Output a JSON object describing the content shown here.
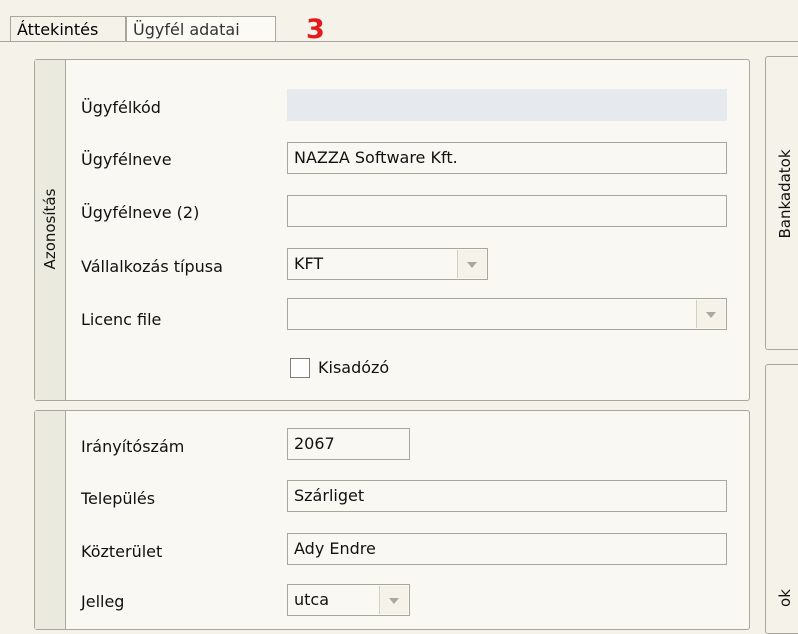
{
  "tabs": [
    {
      "label": "Áttekintés"
    },
    {
      "label": "Ügyfél adatai"
    }
  ],
  "annotation": "3",
  "identification": {
    "title": "Azonosítás",
    "fields": {
      "customer_code": {
        "label": "Ügyfélkód",
        "value": ""
      },
      "customer_name": {
        "label": "Ügyfélneve",
        "value": "NAZZA Software Kft."
      },
      "customer_name2": {
        "label": "Ügyfélneve (2)",
        "value": ""
      },
      "company_type": {
        "label": "Vállalkozás típusa",
        "value": "KFT"
      },
      "license_file": {
        "label": "Licenc file",
        "value": ""
      },
      "small_taxpayer": {
        "label": "Kisadózó",
        "checked": false
      }
    }
  },
  "address": {
    "fields": {
      "zip": {
        "label": "Irányítószám",
        "value": "2067"
      },
      "city": {
        "label": "Település",
        "value": "Szárliget"
      },
      "street": {
        "label": "Közterület",
        "value": "Ady Endre"
      },
      "street_type": {
        "label": "Jelleg",
        "value": "utca"
      }
    }
  },
  "side_tabs": [
    {
      "label": "Bankadatok"
    },
    {
      "label": "ok"
    }
  ],
  "colors": {
    "annotation": "#e21a1a",
    "disabled_field": "#e6eaee",
    "panel_bg": "#f9f8f2"
  }
}
